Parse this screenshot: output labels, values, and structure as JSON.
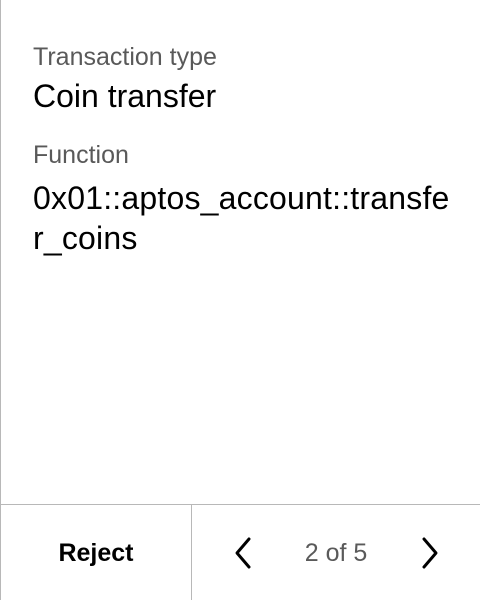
{
  "fields": {
    "transaction_type": {
      "label": "Transaction type",
      "value": "Coin transfer"
    },
    "function": {
      "label": "Function",
      "value": "0x01::aptos_account::transfer_coins"
    }
  },
  "footer": {
    "reject_label": "Reject",
    "prev_icon": "chevron-left-icon",
    "next_icon": "chevron-right-icon",
    "page_indicator": "2 of 5",
    "current_page": 2,
    "total_pages": 5
  },
  "colors": {
    "background": "#ffffff",
    "text_primary": "#000000",
    "text_secondary": "#595959",
    "divider": "#b8b8b8"
  }
}
